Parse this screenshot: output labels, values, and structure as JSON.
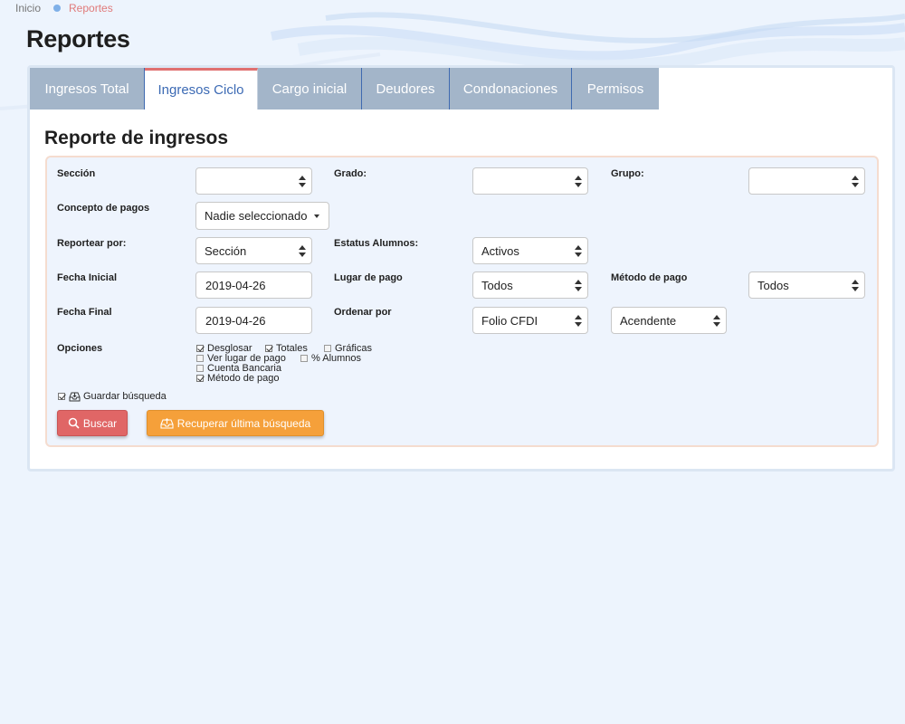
{
  "breadcrumb": {
    "home": "Inicio",
    "current": "Reportes"
  },
  "page_title": "Reportes",
  "tabs": [
    {
      "label": "Ingresos Total",
      "active": false
    },
    {
      "label": "Ingresos Ciclo",
      "active": true
    },
    {
      "label": "Cargo inicial",
      "active": false
    },
    {
      "label": "Deudores",
      "active": false
    },
    {
      "label": "Condonaciones",
      "active": false
    },
    {
      "label": "Permisos",
      "active": false
    }
  ],
  "section_title": "Reporte de ingresos",
  "form": {
    "seccion": {
      "label": "Sección",
      "value": ""
    },
    "grado": {
      "label": "Grado:",
      "value": ""
    },
    "grupo": {
      "label": "Grupo:",
      "value": ""
    },
    "concepto": {
      "label": "Concepto de pagos",
      "value": "Nadie seleccionado"
    },
    "reportear": {
      "label": "Reportear por:",
      "value": "Sección"
    },
    "estatus": {
      "label": "Estatus Alumnos:",
      "value": "Activos"
    },
    "fecha_inicial": {
      "label": "Fecha Inicial",
      "value": "2019-04-26"
    },
    "lugar_pago": {
      "label": "Lugar de pago",
      "value": "Todos"
    },
    "metodo_pago": {
      "label": "Método de pago",
      "value": "Todos"
    },
    "fecha_final": {
      "label": "Fecha Final",
      "value": "2019-04-26"
    },
    "ordenar": {
      "label": "Ordenar por",
      "value": "Folio CFDI",
      "direction": "Acendente"
    },
    "opciones": {
      "label": "Opciones",
      "items": [
        {
          "label": "Desglosar",
          "checked": true
        },
        {
          "label": "Totales",
          "checked": true
        },
        {
          "label": "Gráficas",
          "checked": false
        },
        {
          "label": "Ver lugar de pago",
          "checked": false
        },
        {
          "label": "% Alumnos",
          "checked": false
        },
        {
          "label": "Cuenta Bancaria",
          "checked": false
        },
        {
          "label": "Método de pago",
          "checked": true
        }
      ]
    },
    "guardar": {
      "label": "Guardar búsqueda",
      "checked": true
    },
    "buscar_label": "Buscar",
    "recuperar_label": "Recuperar última búsqueda"
  },
  "colors": {
    "accent_red": "#e06666",
    "accent_orange": "#f5a03a",
    "tab_inactive": "#a3b5c9",
    "tab_active_text": "#3c6ab4"
  }
}
